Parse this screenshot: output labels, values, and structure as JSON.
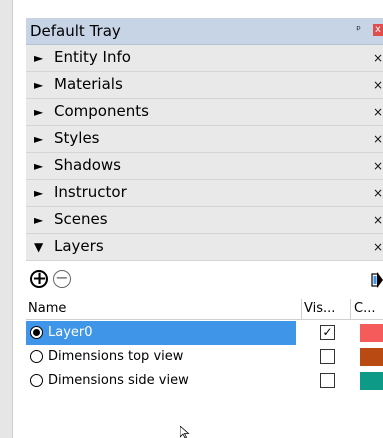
{
  "tray": {
    "title": "Default Tray",
    "pin_glyph": "ᵖ",
    "close_glyph": "x"
  },
  "sections": [
    {
      "label": "Entity Info",
      "expanded": false
    },
    {
      "label": "Materials",
      "expanded": false
    },
    {
      "label": "Components",
      "expanded": false
    },
    {
      "label": "Styles",
      "expanded": false
    },
    {
      "label": "Shadows",
      "expanded": false
    },
    {
      "label": "Instructor",
      "expanded": false
    },
    {
      "label": "Scenes",
      "expanded": false
    },
    {
      "label": "Layers",
      "expanded": true
    }
  ],
  "glyphs": {
    "collapsed": "►",
    "expanded": "▼",
    "section_close": "×",
    "add": "+",
    "remove": "−",
    "check": "✓"
  },
  "layers": {
    "columns": {
      "name": "Name",
      "visible": "Vis...",
      "color": "C..."
    },
    "rows": [
      {
        "name": "Layer0",
        "active": true,
        "visible": true,
        "color": "#f55b5b",
        "selected": true
      },
      {
        "name": "Dimensions top view",
        "active": false,
        "visible": false,
        "color": "#b84a12",
        "selected": false
      },
      {
        "name": "Dimensions side view",
        "active": false,
        "visible": false,
        "color": "#0d9a87",
        "selected": false
      }
    ]
  },
  "colors": {
    "header_bg": "#c6d4e6",
    "section_bg": "#e9e9e9",
    "selection": "#3f95e8"
  }
}
